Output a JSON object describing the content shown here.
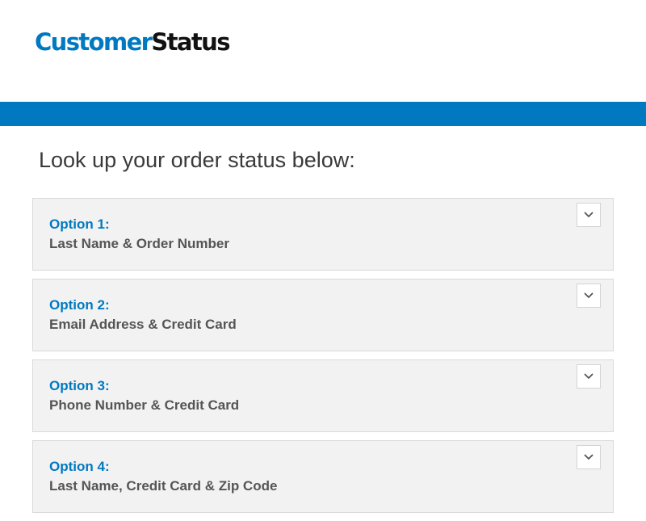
{
  "logo": {
    "part1": "Customer",
    "part2": "Status"
  },
  "colors": {
    "accent": "#0079c1",
    "logo_dark": "#111111",
    "panel_bg": "#f2f2f2",
    "desc_text": "#555555"
  },
  "lead": "Look up your order status below:",
  "options": [
    {
      "title": "Option 1:",
      "description": "Last Name & Order Number",
      "toggle_icon": "chevron-down-icon"
    },
    {
      "title": "Option 2:",
      "description": "Email Address & Credit Card",
      "toggle_icon": "chevron-down-icon"
    },
    {
      "title": "Option 3:",
      "description": "Phone Number & Credit Card",
      "toggle_icon": "chevron-down-icon"
    },
    {
      "title": "Option 4:",
      "description": "Last Name, Credit Card & Zip Code",
      "toggle_icon": "chevron-down-icon"
    }
  ]
}
